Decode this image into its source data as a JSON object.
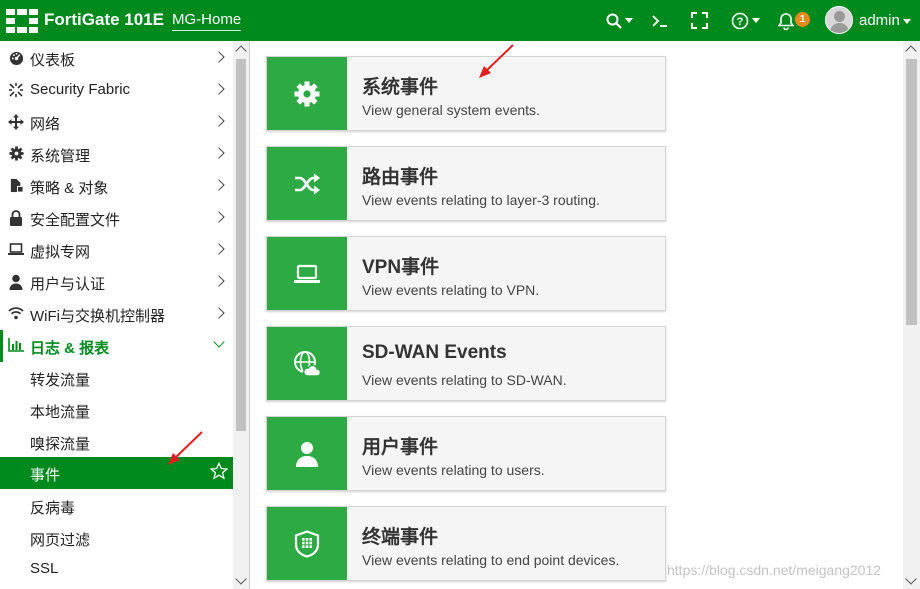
{
  "header": {
    "product": "FortiGate 101E",
    "hostname": "MG-Home",
    "icons": [
      "search-icon",
      "terminal-icon",
      "fullscreen-icon",
      "help-icon",
      "bell-icon"
    ],
    "notification_count": "1",
    "username": "admin",
    "colors": {
      "bar": "#008a1e",
      "badge": "#e8891d"
    }
  },
  "sidebar": {
    "items": [
      {
        "label": "仪表板",
        "icon": "dashboard-icon"
      },
      {
        "label": "Security Fabric",
        "icon": "security-fabric-icon"
      },
      {
        "label": "网络",
        "icon": "network-icon"
      },
      {
        "label": "系统管理",
        "icon": "gear-icon"
      },
      {
        "label": "策略 & 对象",
        "icon": "policy-icon"
      },
      {
        "label": "安全配置文件",
        "icon": "lock-icon"
      },
      {
        "label": "虚拟专网",
        "icon": "laptop-icon"
      },
      {
        "label": "用户与认证",
        "icon": "user-icon"
      },
      {
        "label": "WiFi与交换机控制器",
        "icon": "wifi-icon"
      },
      {
        "label": "日志 & 报表",
        "icon": "bar-chart-icon",
        "expanded": true
      }
    ],
    "sub_items": [
      {
        "label": "转发流量"
      },
      {
        "label": "本地流量"
      },
      {
        "label": "嗅探流量"
      },
      {
        "label": "事件",
        "active": true
      },
      {
        "label": "反病毒"
      },
      {
        "label": "网页过滤"
      },
      {
        "label": "SSL"
      }
    ]
  },
  "main": {
    "cards": [
      {
        "title": "系统事件",
        "description": "View general system events.",
        "icon": "gear-icon"
      },
      {
        "title": "路由事件",
        "description": "View events relating to layer-3 routing.",
        "icon": "shuffle-icon"
      },
      {
        "title": "VPN事件",
        "description": "View events relating to VPN.",
        "icon": "laptop-icon"
      },
      {
        "title": "SD-WAN Events",
        "description": "View events relating to SD-WAN.",
        "icon": "globe-cloud-icon"
      },
      {
        "title": "用户事件",
        "description": "View events relating to users.",
        "icon": "user-icon"
      },
      {
        "title": "终端事件",
        "description": "View events relating to end point devices.",
        "icon": "shield-grid-icon"
      }
    ],
    "card_icon_color": "#2eaa45"
  },
  "watermark": "https://blog.csdn.net/meigang2012"
}
